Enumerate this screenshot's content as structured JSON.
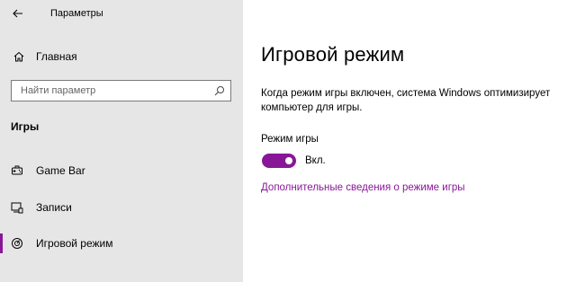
{
  "window": {
    "title": "Параметры"
  },
  "sidebar": {
    "home_label": "Главная",
    "search_placeholder": "Найти параметр",
    "section_heading": "Игры",
    "items": [
      {
        "label": "Game Bar",
        "icon": "game-bar-icon",
        "active": false
      },
      {
        "label": "Записи",
        "icon": "captures-icon",
        "active": false
      },
      {
        "label": "Игровой режим",
        "icon": "game-mode-icon",
        "active": true
      }
    ]
  },
  "main": {
    "title": "Игровой режим",
    "description": "Когда режим игры включен, система Windows оптимизирует компьютер для игры.",
    "toggle": {
      "label": "Режим игры",
      "state_text": "Вкл.",
      "on": true
    },
    "link_text": "Дополнительные сведения о режиме игры"
  },
  "colors": {
    "accent": "#881798",
    "sidebar_bg": "#e6e6e6",
    "content_bg": "#ffffff"
  }
}
